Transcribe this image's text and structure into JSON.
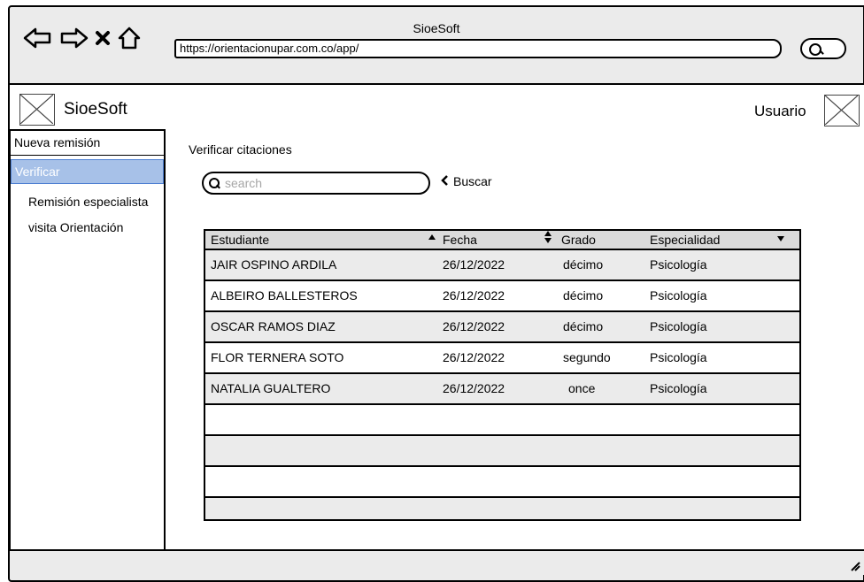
{
  "window": {
    "title": "SioeSoft",
    "url": "https://orientacionupar.com.co/app/"
  },
  "app": {
    "name": "SioeSoft",
    "user": "Usuario"
  },
  "sidebar": {
    "items": [
      {
        "label": "Nueva remisión"
      },
      {
        "label": "Verificar"
      },
      {
        "label": "Remisión especialista"
      },
      {
        "label": "visita Orientación"
      }
    ]
  },
  "main": {
    "title": "Verificar citaciones",
    "search": {
      "placeholder": "search",
      "value": ""
    },
    "buscar_label": "Buscar"
  },
  "table": {
    "columns": [
      "Estudiante",
      "Fecha",
      "Grado",
      "Especialidad"
    ],
    "rows": [
      [
        "JAIR OSPINO ARDILA",
        "26/12/2022",
        "décimo",
        "Psicología"
      ],
      [
        "ALBEIRO BALLESTEROS",
        "26/12/2022",
        "décimo",
        "Psicología"
      ],
      [
        "OSCAR RAMOS DIAZ",
        "26/12/2022",
        "décimo",
        "Psicología"
      ],
      [
        "FLOR TERNERA SOTO",
        "26/12/2022",
        "segundo",
        "Psicología"
      ],
      [
        "NATALIA GUALTERO",
        "26/12/2022",
        "once",
        "Psicología"
      ]
    ]
  },
  "colors": {
    "active_item_bg": "#a7c1e8",
    "active_item_border": "#4d7fd1",
    "header_bg": "#dbdbdb",
    "stripe_bg": "#ebebeb"
  }
}
